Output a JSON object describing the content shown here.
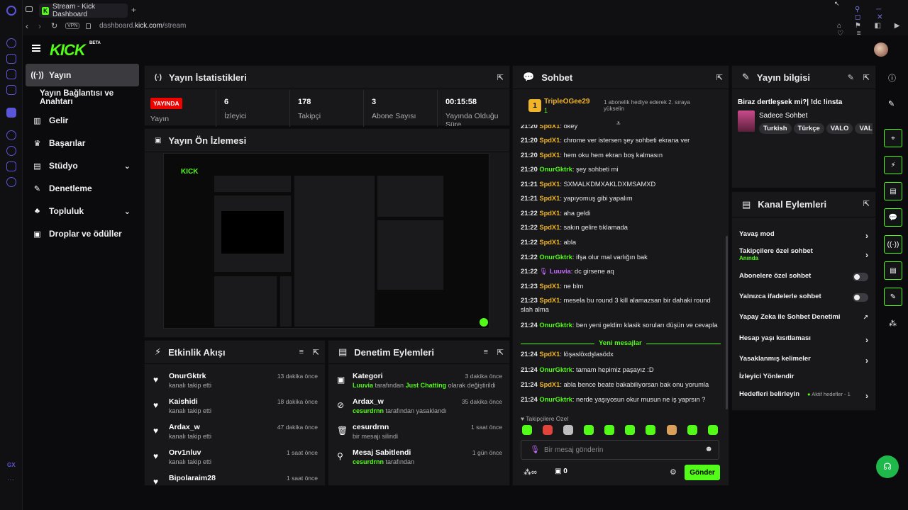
{
  "browser": {
    "tab_title": "Stream - Kick Dashboard",
    "url_prefix": "dashboard.",
    "url_domain": "kick.com",
    "url_path": "/stream",
    "vpn_label": "VPN"
  },
  "brand": {
    "logo": "KICK",
    "beta": "BETA",
    "accent": "#53fc18"
  },
  "sidebar": {
    "items": [
      {
        "label": "Yayın",
        "icon": "broadcast-icon"
      },
      {
        "label": "Yayın Bağlantısı ve Anahtarı"
      },
      {
        "label": "Gelir",
        "icon": "chart-icon"
      },
      {
        "label": "Başarılar",
        "icon": "trophy-icon"
      },
      {
        "label": "Stüdyo",
        "icon": "studio-icon"
      },
      {
        "label": "Denetleme",
        "icon": "wrench-icon"
      },
      {
        "label": "Topluluk",
        "icon": "community-icon"
      },
      {
        "label": "Droplar ve ödüller",
        "icon": "gift-icon"
      }
    ]
  },
  "stats": {
    "title": "Yayın İstatistikleri",
    "live_badge": "YAYINDA",
    "live_label": "Yayın",
    "viewers": "6",
    "viewers_label": "İzleyici",
    "followers": "178",
    "followers_label": "Takipçi",
    "subs": "3",
    "subs_label": "Abone Sayısı",
    "uptime": "00:15:58",
    "uptime_label": "Yayında Olduğu Süre"
  },
  "preview": {
    "title": "Yayın Ön İzlemesi"
  },
  "activity": {
    "title": "Etkinlik Akışı",
    "items": [
      {
        "name": "OnurGktrk",
        "sub": "kanalı takip etti",
        "time": "13 dakika önce"
      },
      {
        "name": "Kaishidi",
        "sub": "kanalı takip etti",
        "time": "18 dakika önce"
      },
      {
        "name": "Ardax_w",
        "sub": "kanalı takip etti",
        "time": "47 dakika önce"
      },
      {
        "name": "Orv1nluv",
        "sub": "kanalı takip etti",
        "time": "1 saat önce"
      },
      {
        "name": "Bipolaraim28",
        "sub": "",
        "time": "1 saat önce"
      }
    ]
  },
  "mod": {
    "title": "Denetim Eylemleri",
    "items": [
      {
        "name": "Kategori",
        "u": "Luuvia",
        "mid": " tarafından ",
        "g2": "Just Chatting",
        "rest": " olarak değiştirildi",
        "time": "3 dakika önce"
      },
      {
        "name": "Ardax_w",
        "u": "cesurdrnn",
        "mid": " tarafından yasaklandı",
        "g2": "",
        "rest": "",
        "time": "35 dakika önce"
      },
      {
        "name": "cesurdrnn",
        "u": "",
        "mid": "bir mesajı silindi",
        "g2": "",
        "rest": "",
        "time": "1 saat önce"
      },
      {
        "name": "Mesaj Sabitlendi",
        "u": "cesurdrnn",
        "mid": " tarafından",
        "g2": "",
        "rest": "",
        "time": "1 gün önce"
      }
    ]
  },
  "chat": {
    "title": "Sohbet",
    "top_gifter": "TripleOGee29",
    "top_gifter_count": "1",
    "gift_note": "1 abonelik hediye ederek 2. sıraya yükselin",
    "messages": [
      {
        "time": "21:20",
        "user": "SpdX1",
        "cls": "u-o",
        "text": "okey"
      },
      {
        "time": "21:20",
        "user": "SpdX1",
        "cls": "u-o",
        "text": "chrome ver istersen şey sohbeti ekrana ver"
      },
      {
        "time": "21:20",
        "user": "SpdX1",
        "cls": "u-o",
        "text": "hem oku hem ekran boş kalmasın"
      },
      {
        "time": "21:20",
        "user": "OnurGktrk",
        "cls": "u-g",
        "text": "şey sohbeti mi"
      },
      {
        "time": "21:21",
        "user": "SpdX1",
        "cls": "u-o",
        "text": "SXMALKDMXAKLDXMSAMXD"
      },
      {
        "time": "21:21",
        "user": "SpdX1",
        "cls": "u-o",
        "text": "yapıyomuş gibi yapalım"
      },
      {
        "time": "21:22",
        "user": "SpdX1",
        "cls": "u-o",
        "text": "aha geldi"
      },
      {
        "time": "21:22",
        "user": "SpdX1",
        "cls": "u-o",
        "text": "sakın gelire tıklamada"
      },
      {
        "time": "21:22",
        "user": "SpdX1",
        "cls": "u-o",
        "text": "abla"
      },
      {
        "time": "21:22",
        "user": "OnurGktrk",
        "cls": "u-g",
        "text": "ifşa olur mal varlığın bak"
      },
      {
        "time": "21:22",
        "user": "Luuvia",
        "cls": "u-p",
        "text": "dc girsene aq"
      },
      {
        "time": "21:23",
        "user": "SpdX1",
        "cls": "u-o",
        "text": "ne blm"
      },
      {
        "time": "21:23",
        "user": "SpdX1",
        "cls": "u-o",
        "text": "mesela bu round 3 kill alamazsan bir dahaki round slah alma"
      },
      {
        "time": "21:24",
        "user": "OnurGktrk",
        "cls": "u-g",
        "text": "ben yeni geldim klasik soruları düşün ve cevapla"
      },
      {
        "time": "21:24",
        "user": "SpdX1",
        "cls": "u-o",
        "text": "löşaslöxdşlasödx"
      },
      {
        "time": "21:24",
        "user": "OnurGktrk",
        "cls": "u-g",
        "text": "tamam hepimiz paşayız :D"
      },
      {
        "time": "21:24",
        "user": "SpdX1",
        "cls": "u-o",
        "text": "abla bence beate bakabiliyorsan bak onu yorumla"
      },
      {
        "time": "21:24",
        "user": "OnurGktrk",
        "cls": "u-g",
        "text": "nerde yaşıyosun okur musun ne iş yaprsın ?"
      }
    ],
    "new_messages": "Yeni mesajlar",
    "followers_only": "Takipçilere Özel",
    "input_placeholder": "Bir mesaj gönderin",
    "points": "0",
    "send": "Gönder"
  },
  "info": {
    "title": "Yayın bilgisi",
    "stream_title": "Biraz dertleşsek mi?| !dc !insta",
    "category": "Sadece Sohbet",
    "tags": [
      "Turkish",
      "Türkçe",
      "VALO",
      "VAL"
    ]
  },
  "actions": {
    "title": "Kanal Eylemleri",
    "rows": [
      {
        "label": "Yavaş mod"
      },
      {
        "label": "Takipçilere özel sohbet",
        "sub": "Anında"
      },
      {
        "label": "Abonelere özel sohbet"
      },
      {
        "label": "Yalnızca ifadelerle sohbet"
      },
      {
        "label": "Yapay Zeka ile Sohbet Denetimi"
      },
      {
        "label": "Hesap yaşı kısıtlaması"
      },
      {
        "label": "Yasaklanmış kelimeler"
      },
      {
        "label": "İzleyici Yönlendir"
      },
      {
        "label": "Hedefleri belirleyin",
        "sub": "Aktif hedefler - 1"
      }
    ]
  }
}
